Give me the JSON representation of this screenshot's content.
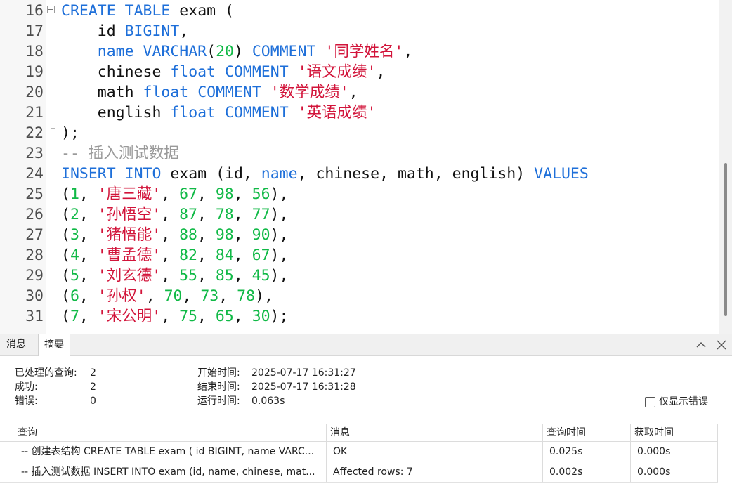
{
  "editor": {
    "lines": [
      {
        "no": "16",
        "tokens": [
          [
            "kw",
            "CREATE"
          ],
          [
            "tx",
            " "
          ],
          [
            "kw",
            "TABLE"
          ],
          [
            "tx",
            " exam ("
          ]
        ]
      },
      {
        "no": "17",
        "tokens": [
          [
            "tx",
            "    id "
          ],
          [
            "kw",
            "BIGINT"
          ],
          [
            "tx",
            ","
          ]
        ]
      },
      {
        "no": "18",
        "tokens": [
          [
            "tx",
            "    "
          ],
          [
            "kw",
            "name"
          ],
          [
            "tx",
            " "
          ],
          [
            "kw",
            "VARCHAR"
          ],
          [
            "tx",
            "("
          ],
          [
            "nm",
            "20"
          ],
          [
            "tx",
            ") "
          ],
          [
            "kw",
            "COMMENT"
          ],
          [
            "tx",
            " "
          ],
          [
            "st",
            "'同学姓名'"
          ],
          [
            "tx",
            ","
          ]
        ]
      },
      {
        "no": "19",
        "tokens": [
          [
            "tx",
            "    chinese "
          ],
          [
            "kw",
            "float"
          ],
          [
            "tx",
            " "
          ],
          [
            "kw",
            "COMMENT"
          ],
          [
            "tx",
            " "
          ],
          [
            "st",
            "'语文成绩'"
          ],
          [
            "tx",
            ","
          ]
        ]
      },
      {
        "no": "20",
        "tokens": [
          [
            "tx",
            "    math "
          ],
          [
            "kw",
            "float"
          ],
          [
            "tx",
            " "
          ],
          [
            "kw",
            "COMMENT"
          ],
          [
            "tx",
            " "
          ],
          [
            "st",
            "'数学成绩'"
          ],
          [
            "tx",
            ","
          ]
        ]
      },
      {
        "no": "21",
        "tokens": [
          [
            "tx",
            "    english "
          ],
          [
            "kw",
            "float"
          ],
          [
            "tx",
            " "
          ],
          [
            "kw",
            "COMMENT"
          ],
          [
            "tx",
            " "
          ],
          [
            "st",
            "'英语成绩'"
          ]
        ]
      },
      {
        "no": "22",
        "tokens": [
          [
            "tx",
            ");"
          ]
        ]
      },
      {
        "no": "23",
        "tokens": [
          [
            "cm",
            "-- 插入测试数据"
          ]
        ]
      },
      {
        "no": "24",
        "tokens": [
          [
            "kw",
            "INSERT"
          ],
          [
            "tx",
            " "
          ],
          [
            "kw",
            "INTO"
          ],
          [
            "tx",
            " exam (id, "
          ],
          [
            "kw",
            "name"
          ],
          [
            "tx",
            ", chinese, math, english) "
          ],
          [
            "kw",
            "VALUES"
          ]
        ]
      },
      {
        "no": "25",
        "tokens": [
          [
            "tx",
            "("
          ],
          [
            "nm",
            "1"
          ],
          [
            "tx",
            ", "
          ],
          [
            "st",
            "'唐三藏'"
          ],
          [
            "tx",
            ", "
          ],
          [
            "nm",
            "67"
          ],
          [
            "tx",
            ", "
          ],
          [
            "nm",
            "98"
          ],
          [
            "tx",
            ", "
          ],
          [
            "nm",
            "56"
          ],
          [
            "tx",
            "),"
          ]
        ]
      },
      {
        "no": "26",
        "tokens": [
          [
            "tx",
            "("
          ],
          [
            "nm",
            "2"
          ],
          [
            "tx",
            ", "
          ],
          [
            "st",
            "'孙悟空'"
          ],
          [
            "tx",
            ", "
          ],
          [
            "nm",
            "87"
          ],
          [
            "tx",
            ", "
          ],
          [
            "nm",
            "78"
          ],
          [
            "tx",
            ", "
          ],
          [
            "nm",
            "77"
          ],
          [
            "tx",
            "),"
          ]
        ]
      },
      {
        "no": "27",
        "tokens": [
          [
            "tx",
            "("
          ],
          [
            "nm",
            "3"
          ],
          [
            "tx",
            ", "
          ],
          [
            "st",
            "'猪悟能'"
          ],
          [
            "tx",
            ", "
          ],
          [
            "nm",
            "88"
          ],
          [
            "tx",
            ", "
          ],
          [
            "nm",
            "98"
          ],
          [
            "tx",
            ", "
          ],
          [
            "nm",
            "90"
          ],
          [
            "tx",
            "),"
          ]
        ]
      },
      {
        "no": "28",
        "tokens": [
          [
            "tx",
            "("
          ],
          [
            "nm",
            "4"
          ],
          [
            "tx",
            ", "
          ],
          [
            "st",
            "'曹孟德'"
          ],
          [
            "tx",
            ", "
          ],
          [
            "nm",
            "82"
          ],
          [
            "tx",
            ", "
          ],
          [
            "nm",
            "84"
          ],
          [
            "tx",
            ", "
          ],
          [
            "nm",
            "67"
          ],
          [
            "tx",
            "),"
          ]
        ]
      },
      {
        "no": "29",
        "tokens": [
          [
            "tx",
            "("
          ],
          [
            "nm",
            "5"
          ],
          [
            "tx",
            ", "
          ],
          [
            "st",
            "'刘玄德'"
          ],
          [
            "tx",
            ", "
          ],
          [
            "nm",
            "55"
          ],
          [
            "tx",
            ", "
          ],
          [
            "nm",
            "85"
          ],
          [
            "tx",
            ", "
          ],
          [
            "nm",
            "45"
          ],
          [
            "tx",
            "),"
          ]
        ]
      },
      {
        "no": "30",
        "tokens": [
          [
            "tx",
            "("
          ],
          [
            "nm",
            "6"
          ],
          [
            "tx",
            ", "
          ],
          [
            "st",
            "'孙权'"
          ],
          [
            "tx",
            ", "
          ],
          [
            "nm",
            "70"
          ],
          [
            "tx",
            ", "
          ],
          [
            "nm",
            "73"
          ],
          [
            "tx",
            ", "
          ],
          [
            "nm",
            "78"
          ],
          [
            "tx",
            "),"
          ]
        ]
      },
      {
        "no": "31",
        "tokens": [
          [
            "tx",
            "("
          ],
          [
            "nm",
            "7"
          ],
          [
            "tx",
            ", "
          ],
          [
            "st",
            "'宋公明'"
          ],
          [
            "tx",
            ", "
          ],
          [
            "nm",
            "75"
          ],
          [
            "tx",
            ", "
          ],
          [
            "nm",
            "65"
          ],
          [
            "tx",
            ", "
          ],
          [
            "nm",
            "30"
          ],
          [
            "tx",
            ");"
          ]
        ]
      }
    ]
  },
  "tabs": {
    "messages": "消息",
    "summary": "摘要"
  },
  "icons": {
    "collapse": "chevron-up-icon",
    "close": "close-icon"
  },
  "summary": {
    "processed_label": "已处理的查询:",
    "processed_value": "2",
    "success_label": "成功:",
    "success_value": "2",
    "errors_label": "错误:",
    "errors_value": "0",
    "start_label": "开始时间:",
    "start_value": "2025-07-17 16:31:27",
    "end_label": "结束时间:",
    "end_value": "2025-07-17 16:31:28",
    "run_label": "运行时间:",
    "run_value": "0.063s",
    "only_errors_label": "仅显示错误"
  },
  "grid": {
    "columns": [
      "查询",
      "消息",
      "查询时间",
      "获取时间"
    ],
    "rows": [
      [
        "-- 创建表结构 CREATE TABLE exam ( id BIGINT, name VARC...",
        "OK",
        "0.025s",
        "0.000s"
      ],
      [
        "-- 插入测试数据 INSERT INTO exam (id, name, chinese, mat...",
        "Affected rows: 7",
        "0.002s",
        "0.000s"
      ]
    ]
  },
  "colors": {
    "keyword": "#1e6fd9",
    "string": "#d2143a",
    "number": "#10b946",
    "comment": "#9a9a9a"
  }
}
